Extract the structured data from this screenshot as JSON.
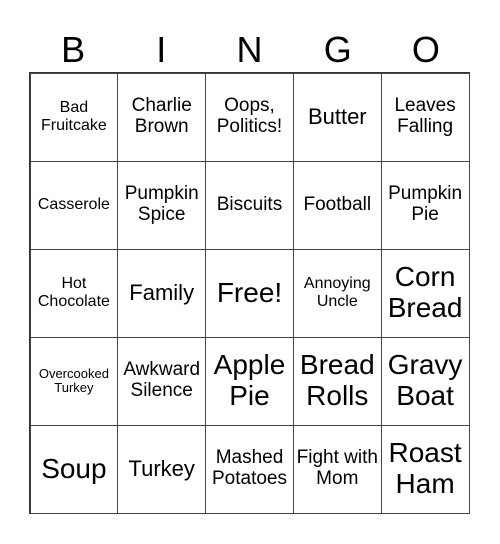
{
  "header": [
    "B",
    "I",
    "N",
    "G",
    "O"
  ],
  "rows": [
    [
      {
        "text": "Bad Fruitcake",
        "size": 2
      },
      {
        "text": "Charlie Brown",
        "size": 3
      },
      {
        "text": "Oops, Politics!",
        "size": 3
      },
      {
        "text": "Butter",
        "size": 4
      },
      {
        "text": "Leaves Falling",
        "size": 3
      }
    ],
    [
      {
        "text": "Casserole",
        "size": 2
      },
      {
        "text": "Pumpkin Spice",
        "size": 3
      },
      {
        "text": "Biscuits",
        "size": 3
      },
      {
        "text": "Football",
        "size": 3
      },
      {
        "text": "Pumpkin Pie",
        "size": 3
      }
    ],
    [
      {
        "text": "Hot Chocolate",
        "size": 2
      },
      {
        "text": "Family",
        "size": 4
      },
      {
        "text": "Free!",
        "size": 5
      },
      {
        "text": "Annoying Uncle",
        "size": 2
      },
      {
        "text": "Corn Bread",
        "size": 5
      }
    ],
    [
      {
        "text": "Overcooked Turkey",
        "size": 1
      },
      {
        "text": "Awkward Silence",
        "size": 3
      },
      {
        "text": "Apple Pie",
        "size": 5
      },
      {
        "text": "Bread Rolls",
        "size": 5
      },
      {
        "text": "Gravy Boat",
        "size": 5
      }
    ],
    [
      {
        "text": "Soup",
        "size": 5
      },
      {
        "text": "Turkey",
        "size": 4
      },
      {
        "text": "Mashed Potatoes",
        "size": 3
      },
      {
        "text": "Fight with Mom",
        "size": 3
      },
      {
        "text": "Roast Ham",
        "size": 5
      }
    ]
  ]
}
